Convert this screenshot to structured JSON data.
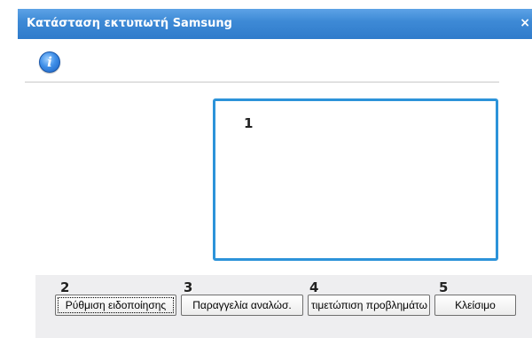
{
  "window": {
    "title": "Κατάσταση εκτυπωτή Samsung",
    "close_glyph": "×"
  },
  "icons": {
    "info": "info-icon",
    "info_glyph": "i"
  },
  "message_box": {
    "callout": "1"
  },
  "buttons": [
    {
      "label": "Ρύθμιση ειδοποίησης",
      "callout": "2"
    },
    {
      "label": "Παραγγελία αναλώσ.",
      "callout": "3"
    },
    {
      "label": "τιμετώπιση προβλημάτω",
      "callout": "4"
    },
    {
      "label": "Κλείσιμο",
      "callout": "5"
    }
  ],
  "colors": {
    "titlebar": "#3e8ad6",
    "message_border": "#2c93d9",
    "footer": "#eeeef0"
  }
}
